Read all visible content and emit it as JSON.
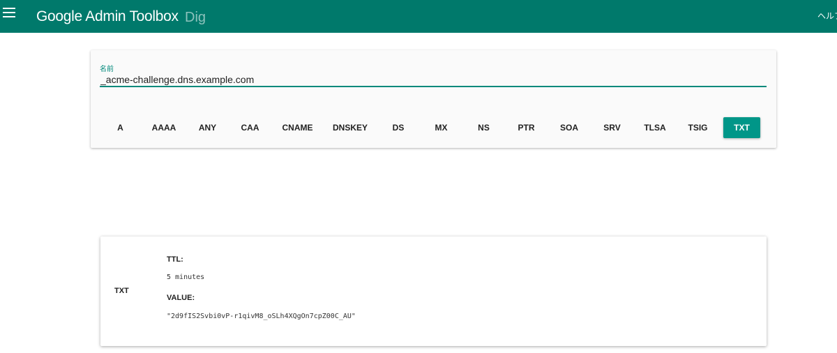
{
  "appbar": {
    "title": "Google Admin Toolbox",
    "subtitle": "Dig",
    "help_label": "ヘルプ",
    "menu_icon": "hamburger-menu-icon"
  },
  "query": {
    "name_label": "名前",
    "name_value": "_acme-challenge.dns.example.com",
    "record_types": [
      "A",
      "AAAA",
      "ANY",
      "CAA",
      "CNAME",
      "DNSKEY",
      "DS",
      "MX",
      "NS",
      "PTR",
      "SOA",
      "SRV",
      "TLSA",
      "TSIG",
      "TXT"
    ],
    "selected_type": "TXT",
    "accent_color": "#009688"
  },
  "result": {
    "type": "TXT",
    "ttl_label": "TTL:",
    "ttl_value": "5 minutes",
    "value_label": "VALUE:",
    "value": "\"2d9fIS2Svbi0vP-r1qivM8_oSLh4XQgOn7cpZ00C_AU\""
  }
}
